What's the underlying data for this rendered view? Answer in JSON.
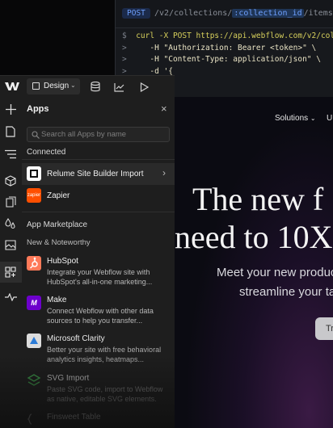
{
  "terminal": {
    "method": "POST",
    "path_prefix": "/v2/collections/",
    "path_param": ":collection_id",
    "path_suffix": "/items/li",
    "lines": [
      {
        "prompt": "$",
        "code": "curl -X POST https://api.webflow.com/v2/colle"
      },
      {
        "prompt": ">",
        "code": "    -H \"Authorization: Bearer <token>\" \\"
      },
      {
        "prompt": ">",
        "code": "    -H \"Content-Type: application/json\" \\"
      },
      {
        "prompt": ">",
        "code": "    -d '{"
      }
    ]
  },
  "toolbar": {
    "mode_label": "Design",
    "logo_text": "W"
  },
  "panel": {
    "title": "Apps",
    "search_placeholder": "Search all Apps by name",
    "connected_heading": "Connected",
    "connected": [
      {
        "name": "Relume Site Builder Import",
        "color": "#ffffff"
      },
      {
        "name": "Zapier",
        "color": "#ff4f00",
        "logo_text": "zapier"
      }
    ],
    "marketplace_heading": "App Marketplace",
    "new_heading": "New & Noteworthy",
    "marketplace": [
      {
        "name": "HubSpot",
        "desc1": "Integrate your Webflow site with",
        "desc2": "HubSpot's all-in-one marketing...",
        "color": "#ff7a59"
      },
      {
        "name": "Make",
        "desc1": "Connect Webflow with other data",
        "desc2": "sources to help you transfer...",
        "color": "#6d00cc"
      },
      {
        "name": "Microsoft Clarity",
        "desc1": "Better your site with free behavioral",
        "desc2": "analytics insights, heatmaps...",
        "color": "#2b7bd6"
      },
      {
        "name": "SVG Import",
        "desc1": "Paste SVG code, import to Webflow",
        "desc2": "as native, editable SVG elements.",
        "color": "#2f8a3a"
      },
      {
        "name": "Finsweet Table",
        "desc1": "",
        "desc2": "",
        "color": "#444444"
      }
    ]
  },
  "site": {
    "nav_solutions": "Solutions",
    "nav_next": "U",
    "headline1": "The new f",
    "headline2": "need to 10X",
    "subline1": "Meet your new product",
    "subline2": "streamline your ta",
    "button_label": "Tr"
  }
}
